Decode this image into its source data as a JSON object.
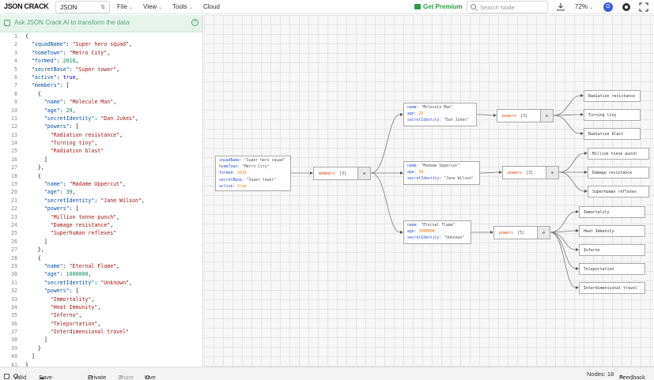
{
  "app": {
    "name": "JSON CRACK"
  },
  "header": {
    "format_value": "JSON",
    "menu": [
      "File",
      "View",
      "Tools",
      "Cloud"
    ],
    "premium_label": "Get Premium",
    "search_placeholder": "Search Node",
    "zoom": "72%",
    "avatar_initial": "G"
  },
  "ai_bar": {
    "placeholder": "Ask JSON Crack AI to transform the data",
    "help": "?"
  },
  "editor": {
    "lines": [
      [
        [
          "p",
          "{"
        ]
      ],
      [
        [
          "p",
          "  "
        ],
        [
          "k",
          "\"squadName\""
        ],
        [
          "p",
          ": "
        ],
        [
          "s",
          "\"Super hero squad\""
        ],
        [
          "p",
          ","
        ]
      ],
      [
        [
          "p",
          "  "
        ],
        [
          "k",
          "\"homeTown\""
        ],
        [
          "p",
          ": "
        ],
        [
          "s",
          "\"Metro City\""
        ],
        [
          "p",
          ","
        ]
      ],
      [
        [
          "p",
          "  "
        ],
        [
          "k",
          "\"formed\""
        ],
        [
          "p",
          ": "
        ],
        [
          "n",
          "2016"
        ],
        [
          "p",
          ","
        ]
      ],
      [
        [
          "p",
          "  "
        ],
        [
          "k",
          "\"secretBase\""
        ],
        [
          "p",
          ": "
        ],
        [
          "s",
          "\"Super tower\""
        ],
        [
          "p",
          ","
        ]
      ],
      [
        [
          "p",
          "  "
        ],
        [
          "k",
          "\"active\""
        ],
        [
          "p",
          ": "
        ],
        [
          "b",
          "true"
        ],
        [
          "p",
          ","
        ]
      ],
      [
        [
          "p",
          "  "
        ],
        [
          "k",
          "\"members\""
        ],
        [
          "p",
          ": ["
        ]
      ],
      [
        [
          "p",
          "    {"
        ]
      ],
      [
        [
          "p",
          "      "
        ],
        [
          "k",
          "\"name\""
        ],
        [
          "p",
          ": "
        ],
        [
          "s",
          "\"Molecule Man\""
        ],
        [
          "p",
          ","
        ]
      ],
      [
        [
          "p",
          "      "
        ],
        [
          "k",
          "\"age\""
        ],
        [
          "p",
          ": "
        ],
        [
          "n",
          "29"
        ],
        [
          "p",
          ","
        ]
      ],
      [
        [
          "p",
          "      "
        ],
        [
          "k",
          "\"secretIdentity\""
        ],
        [
          "p",
          ": "
        ],
        [
          "s",
          "\"Dan Jukes\""
        ],
        [
          "p",
          ","
        ]
      ],
      [
        [
          "p",
          "      "
        ],
        [
          "k",
          "\"powers\""
        ],
        [
          "p",
          ": ["
        ]
      ],
      [
        [
          "p",
          "        "
        ],
        [
          "s",
          "\"Radiation resistance\""
        ],
        [
          "p",
          ","
        ]
      ],
      [
        [
          "p",
          "        "
        ],
        [
          "s",
          "\"Turning tiny\""
        ],
        [
          "p",
          ","
        ]
      ],
      [
        [
          "p",
          "        "
        ],
        [
          "s",
          "\"Radiation blast\""
        ]
      ],
      [
        [
          "p",
          "      ]"
        ]
      ],
      [
        [
          "p",
          "    },"
        ]
      ],
      [
        [
          "p",
          "    {"
        ]
      ],
      [
        [
          "p",
          "      "
        ],
        [
          "k",
          "\"name\""
        ],
        [
          "p",
          ": "
        ],
        [
          "s",
          "\"Madame Uppercut\""
        ],
        [
          "p",
          ","
        ]
      ],
      [
        [
          "p",
          "      "
        ],
        [
          "k",
          "\"age\""
        ],
        [
          "p",
          ": "
        ],
        [
          "n",
          "39"
        ],
        [
          "p",
          ","
        ]
      ],
      [
        [
          "p",
          "      "
        ],
        [
          "k",
          "\"secretIdentity\""
        ],
        [
          "p",
          ": "
        ],
        [
          "s",
          "\"Jane Wilson\""
        ],
        [
          "p",
          ","
        ]
      ],
      [
        [
          "p",
          "      "
        ],
        [
          "k",
          "\"powers\""
        ],
        [
          "p",
          ": ["
        ]
      ],
      [
        [
          "p",
          "        "
        ],
        [
          "s",
          "\"Million tonne punch\""
        ],
        [
          "p",
          ","
        ]
      ],
      [
        [
          "p",
          "        "
        ],
        [
          "s",
          "\"Damage resistance\""
        ],
        [
          "p",
          ","
        ]
      ],
      [
        [
          "p",
          "        "
        ],
        [
          "s",
          "\"Superhuman reflexes\""
        ]
      ],
      [
        [
          "p",
          "      ]"
        ]
      ],
      [
        [
          "p",
          "    },"
        ]
      ],
      [
        [
          "p",
          "    {"
        ]
      ],
      [
        [
          "p",
          "      "
        ],
        [
          "k",
          "\"name\""
        ],
        [
          "p",
          ": "
        ],
        [
          "s",
          "\"Eternal Flame\""
        ],
        [
          "p",
          ","
        ]
      ],
      [
        [
          "p",
          "      "
        ],
        [
          "k",
          "\"age\""
        ],
        [
          "p",
          ": "
        ],
        [
          "n",
          "1000000"
        ],
        [
          "p",
          ","
        ]
      ],
      [
        [
          "p",
          "      "
        ],
        [
          "k",
          "\"secretIdentity\""
        ],
        [
          "p",
          ": "
        ],
        [
          "s",
          "\"Unknown\""
        ],
        [
          "p",
          ","
        ]
      ],
      [
        [
          "p",
          "      "
        ],
        [
          "k",
          "\"powers\""
        ],
        [
          "p",
          ": ["
        ]
      ],
      [
        [
          "p",
          "        "
        ],
        [
          "s",
          "\"Immortality\""
        ],
        [
          "p",
          ","
        ]
      ],
      [
        [
          "p",
          "        "
        ],
        [
          "s",
          "\"Heat Immunity\""
        ],
        [
          "p",
          ","
        ]
      ],
      [
        [
          "p",
          "        "
        ],
        [
          "s",
          "\"Inferno\""
        ],
        [
          "p",
          ","
        ]
      ],
      [
        [
          "p",
          "        "
        ],
        [
          "s",
          "\"Teleportation\""
        ],
        [
          "p",
          ","
        ]
      ],
      [
        [
          "p",
          "        "
        ],
        [
          "s",
          "\"Interdimensional travel\""
        ]
      ],
      [
        [
          "p",
          "      ]"
        ]
      ],
      [
        [
          "p",
          "    }"
        ]
      ],
      [
        [
          "p",
          "  ]"
        ]
      ],
      [
        [
          "p",
          "}"
        ]
      ]
    ]
  },
  "graph": {
    "root": {
      "rows": [
        [
          "squadName",
          "\"Super hero squad\"",
          "s"
        ],
        [
          "homeTown",
          "\"Metro City\"",
          "s"
        ],
        [
          "formed",
          "2016",
          "n"
        ],
        [
          "secretBase",
          "\"Super tower\"",
          "s"
        ],
        [
          "active",
          "true",
          "b"
        ]
      ]
    },
    "members_node": {
      "key": "members",
      "count": "[3]",
      "toggle": "⊖"
    },
    "members": [
      {
        "rows": [
          [
            "name",
            "\"Molecule Man\"",
            "s"
          ],
          [
            "age",
            "29",
            "n"
          ],
          [
            "secretIdentity",
            "\"Dan Jukes\"",
            "s"
          ]
        ],
        "powers": {
          "key": "powers",
          "count": "[3]",
          "toggle": "⊖"
        },
        "leaves": [
          "Radiation resistance",
          "Turning tiny",
          "Radiation blast"
        ]
      },
      {
        "rows": [
          [
            "name",
            "\"Madame Uppercut\"",
            "s"
          ],
          [
            "age",
            "39",
            "n"
          ],
          [
            "secretIdentity",
            "\"Jane Wilson\"",
            "s"
          ]
        ],
        "powers": {
          "key": "powers",
          "count": "[3]",
          "toggle": "⊖"
        },
        "leaves": [
          "Million tonne punch",
          "Damage resistance",
          "Superhuman reflexes"
        ]
      },
      {
        "rows": [
          [
            "name",
            "\"Eternal Flame\"",
            "s"
          ],
          [
            "age",
            "1000000",
            "n"
          ],
          [
            "secretIdentity",
            "\"Unknown\"",
            "s"
          ]
        ],
        "powers": {
          "key": "powers",
          "count": "[5]",
          "toggle": "⊖"
        },
        "leaves": [
          "Immortality",
          "Heat Immunity",
          "Inferno",
          "Teleportation",
          "Interdimensional travel"
        ]
      }
    ]
  },
  "status": {
    "valid": "Valid",
    "save": "Save to Cloud",
    "private": "Private",
    "share": "Share",
    "live": "Live Transform",
    "nodes": "Nodes: 18",
    "feedback": "Feedback"
  }
}
